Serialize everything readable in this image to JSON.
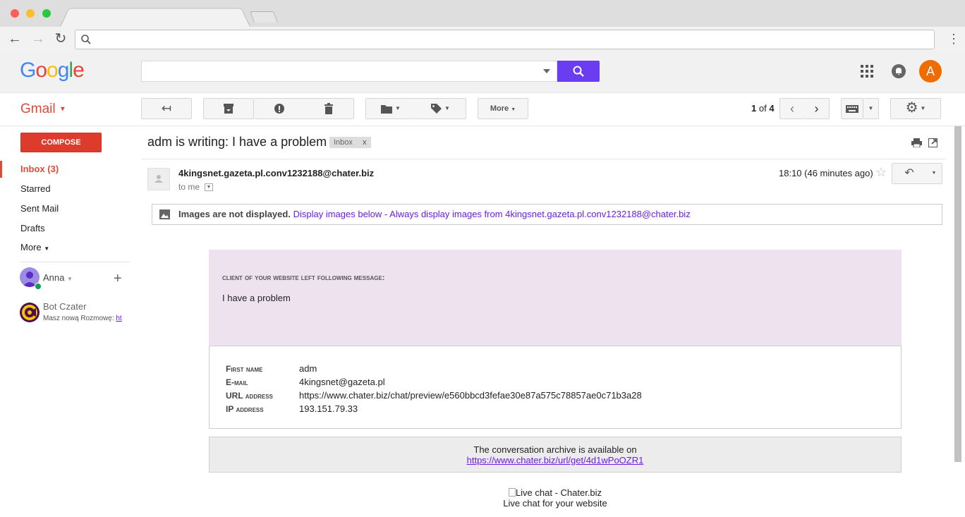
{
  "browser": {
    "tab_title": "",
    "address": ""
  },
  "header": {
    "logo_letters": [
      "G",
      "o",
      "o",
      "g",
      "l",
      "e"
    ],
    "logo_colors": [
      "#4285f4",
      "#ea4335",
      "#fbbc05",
      "#4285f4",
      "#34a853",
      "#ea4335"
    ],
    "search_placeholder": "",
    "avatar_initial": "A",
    "accent": "#6b3df0"
  },
  "toolbar": {
    "gmail_label": "Gmail",
    "more_label": "More",
    "page_current": "1",
    "page_of": "of",
    "page_total": "4"
  },
  "sidebar": {
    "compose_label": "COMPOSE",
    "items": [
      {
        "label": "Inbox (3)"
      },
      {
        "label": "Starred"
      },
      {
        "label": "Sent Mail"
      },
      {
        "label": "Drafts"
      },
      {
        "label": "More"
      }
    ],
    "hangouts_user": "Anna",
    "chat": {
      "name": "Bot Czater",
      "preview": "Masz nową Rozmowę: ",
      "preview_link": "ht"
    }
  },
  "email": {
    "subject": "adm is writing: I have a problem",
    "label_badge": "Inbox",
    "label_close": "x",
    "sender": "4kingsnet.gazeta.pl.conv1232188@chater.biz",
    "to": "to me",
    "time": "18:10 (46 minutes ago)",
    "images_notice": "Images are not displayed.",
    "display_below": "Display images below",
    "separator": " - ",
    "always_display": "Always display images from 4kingsnet.gazeta.pl.conv1232188@chater.biz",
    "heading": "client of your website left following message:",
    "message": "I have a problem",
    "fields": [
      {
        "label": "First name",
        "value": "adm"
      },
      {
        "label": "E-mail",
        "value": "4kingsnet@gazeta.pl"
      },
      {
        "label": "URL address",
        "value": "https://www.chater.biz/chat/preview/e560bbcd3fefae30e87a575c78857ae0c71b3a28"
      },
      {
        "label": "IP address",
        "value": "193.151.79.33"
      }
    ],
    "archive_text": "The conversation archive is available on",
    "archive_link": "https://www.chater.biz/url/get/4d1wPoOZR1",
    "logo_alt": "Live chat - Chater.biz",
    "tagline": "Live chat for your website"
  }
}
